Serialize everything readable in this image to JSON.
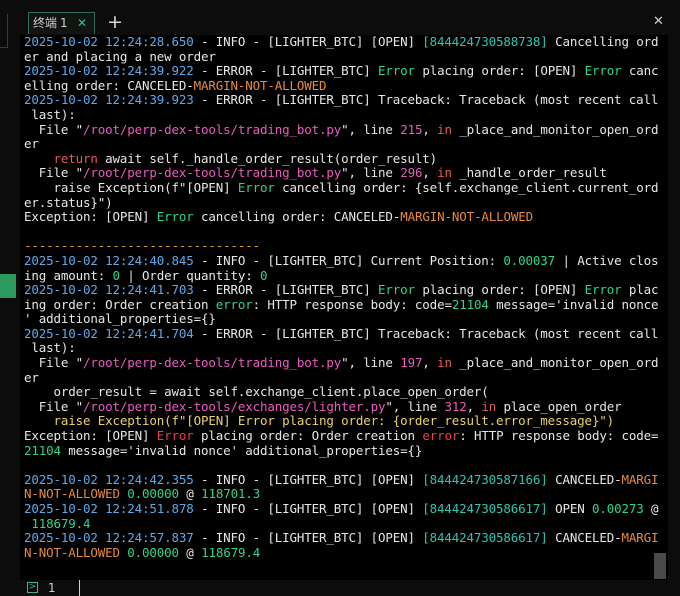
{
  "tab": {
    "label": "终端",
    "index": "1",
    "close": "✕"
  },
  "new_tab": "+",
  "window_close": "✕",
  "bottom": {
    "session": "1"
  },
  "log": [
    [
      [
        "2025-10-02 12:24:28.650",
        "ts"
      ],
      [
        " - INFO - [LIGHTER_BTC] [OPEN] ",
        ""
      ],
      [
        "[844424730588738]",
        "cy"
      ],
      [
        " Cancelling ord",
        ""
      ]
    ],
    [
      [
        "er and placing a new order",
        ""
      ]
    ],
    [
      [
        "2025-10-02 12:24:39.922",
        "ts"
      ],
      [
        " - ERROR - [LIGHTER_BTC] ",
        ""
      ],
      [
        "Error",
        "gr"
      ],
      [
        " placing order: [OPEN] ",
        ""
      ],
      [
        "Error",
        "gr"
      ],
      [
        " canc",
        ""
      ]
    ],
    [
      [
        "elling order: CANCELED-",
        ""
      ],
      [
        "MARGIN-NOT-ALLOWED",
        "or"
      ]
    ],
    [
      [
        "2025-10-02 12:24:39.923",
        "ts"
      ],
      [
        " - ERROR - [LIGHTER_BTC] Traceback: Traceback (most recent call",
        ""
      ]
    ],
    [
      [
        " last):",
        ""
      ]
    ],
    [
      [
        "  File \"",
        ""
      ],
      [
        "/root/perp-dex-tools/trading_bot.py",
        "mg"
      ],
      [
        "\", line ",
        ""
      ],
      [
        "215",
        "mg"
      ],
      [
        ", ",
        ""
      ],
      [
        "in",
        "rd2"
      ],
      [
        " _place_and_monitor_open_ord",
        ""
      ]
    ],
    [
      [
        "er",
        ""
      ]
    ],
    [
      [
        "    ",
        ""
      ],
      [
        "return",
        "rd2"
      ],
      [
        " await self._handle_order_result(order_result)",
        ""
      ]
    ],
    [
      [
        "  File \"",
        ""
      ],
      [
        "/root/perp-dex-tools/trading_bot.py",
        "mg"
      ],
      [
        "\", line ",
        ""
      ],
      [
        "296",
        "mg"
      ],
      [
        ", ",
        ""
      ],
      [
        "in",
        "rd2"
      ],
      [
        " _handle_order_result",
        ""
      ]
    ],
    [
      [
        "    raise Exception(f\"[OPEN] ",
        ""
      ],
      [
        "Error",
        "gr"
      ],
      [
        " cancelling order: {self.exchange_client.current_ord",
        ""
      ]
    ],
    [
      [
        "er.status}\")",
        ""
      ]
    ],
    [
      [
        "Exception: [OPEN] ",
        ""
      ],
      [
        "Error",
        "gr"
      ],
      [
        " cancelling order: CANCELED-",
        ""
      ],
      [
        "MARGIN-NOT-ALLOWED",
        "or"
      ]
    ],
    [
      [
        "",
        ""
      ]
    ],
    [
      [
        "--------------------------------",
        "sep"
      ]
    ],
    [
      [
        "2025-10-02 12:24:40.845",
        "ts"
      ],
      [
        " - INFO - [LIGHTER_BTC] Current Position: ",
        ""
      ],
      [
        "0.00037",
        "gr"
      ],
      [
        " | Active clos",
        ""
      ]
    ],
    [
      [
        "ing amount: ",
        ""
      ],
      [
        "0",
        "gr"
      ],
      [
        " | Order quantity: ",
        ""
      ],
      [
        "0",
        "gr"
      ]
    ],
    [
      [
        "2025-10-02 12:24:41.703",
        "ts"
      ],
      [
        " - ERROR - [LIGHTER_BTC] ",
        ""
      ],
      [
        "Error",
        "gr"
      ],
      [
        " placing order: [OPEN] ",
        ""
      ],
      [
        "Error",
        "gr"
      ],
      [
        " plac",
        ""
      ]
    ],
    [
      [
        "ing order: Order creation ",
        ""
      ],
      [
        "error",
        "gr"
      ],
      [
        ": HTTP response body: code=",
        ""
      ],
      [
        "21104",
        "gr"
      ],
      [
        " message='invalid nonce",
        ""
      ]
    ],
    [
      [
        "' additional_properties={}",
        ""
      ]
    ],
    [
      [
        "2025-10-02 12:24:41.704",
        "ts"
      ],
      [
        " - ERROR - [LIGHTER_BTC] Traceback: Traceback (most recent call",
        ""
      ]
    ],
    [
      [
        " last):",
        ""
      ]
    ],
    [
      [
        "  File \"",
        ""
      ],
      [
        "/root/perp-dex-tools/trading_bot.py",
        "mg"
      ],
      [
        "\", line ",
        ""
      ],
      [
        "197",
        "mg"
      ],
      [
        ", ",
        ""
      ],
      [
        "in",
        "rd2"
      ],
      [
        " _place_and_monitor_open_ord",
        ""
      ]
    ],
    [
      [
        "er",
        ""
      ]
    ],
    [
      [
        "    order_result = await self.exchange_client.place_open_order(",
        ""
      ]
    ],
    [
      [
        "  File \"",
        ""
      ],
      [
        "/root/perp-dex-tools/exchanges/lighter.py",
        "mg"
      ],
      [
        "\", line ",
        ""
      ],
      [
        "312",
        "mg"
      ],
      [
        ", ",
        ""
      ],
      [
        "in",
        "rd2"
      ],
      [
        " place_open_order",
        ""
      ]
    ],
    [
      [
        "    raise Exception(f\"[OPEN] Error placing order: {order_result.error_message}\")",
        "yl"
      ]
    ],
    [
      [
        "Exception: [OPEN] ",
        ""
      ],
      [
        "Error",
        "rd"
      ],
      [
        " placing order: Order creation ",
        ""
      ],
      [
        "error",
        "rd"
      ],
      [
        ": HTTP response body: code=",
        ""
      ]
    ],
    [
      [
        "21104",
        "gr"
      ],
      [
        " message='invalid nonce' additional_properties={}",
        ""
      ]
    ],
    [
      [
        "",
        ""
      ]
    ],
    [
      [
        "2025-10-02 12:24:42.355",
        "ts"
      ],
      [
        " - INFO - [LIGHTER_BTC] [OPEN] ",
        ""
      ],
      [
        "[844424730587166]",
        "cy"
      ],
      [
        " CANCELED-",
        ""
      ],
      [
        "MARGI",
        "or"
      ]
    ],
    [
      [
        "N-NOT-ALLOWED",
        "or"
      ],
      [
        " ",
        ""
      ],
      [
        "0.00000",
        "gr"
      ],
      [
        " @ ",
        ""
      ],
      [
        "118701.3",
        "gr"
      ]
    ],
    [
      [
        "2025-10-02 12:24:51.878",
        "ts"
      ],
      [
        " - INFO - [LIGHTER_BTC] [OPEN] ",
        ""
      ],
      [
        "[844424730586617]",
        "cy"
      ],
      [
        " OPEN ",
        ""
      ],
      [
        "0.00273",
        "gr"
      ],
      [
        " @",
        ""
      ]
    ],
    [
      [
        " ",
        ""
      ],
      [
        "118679.4",
        "gr"
      ]
    ],
    [
      [
        "2025-10-02 12:24:57.837",
        "ts"
      ],
      [
        " - INFO - [LIGHTER_BTC] [OPEN] ",
        ""
      ],
      [
        "[844424730586617]",
        "cy"
      ],
      [
        " CANCELED-",
        ""
      ],
      [
        "MARGI",
        "or"
      ]
    ],
    [
      [
        "N-NOT-ALLOWED",
        "or"
      ],
      [
        " ",
        ""
      ],
      [
        "0.00000",
        "gr"
      ],
      [
        " @ ",
        ""
      ],
      [
        "118679.4",
        "gr"
      ]
    ]
  ]
}
